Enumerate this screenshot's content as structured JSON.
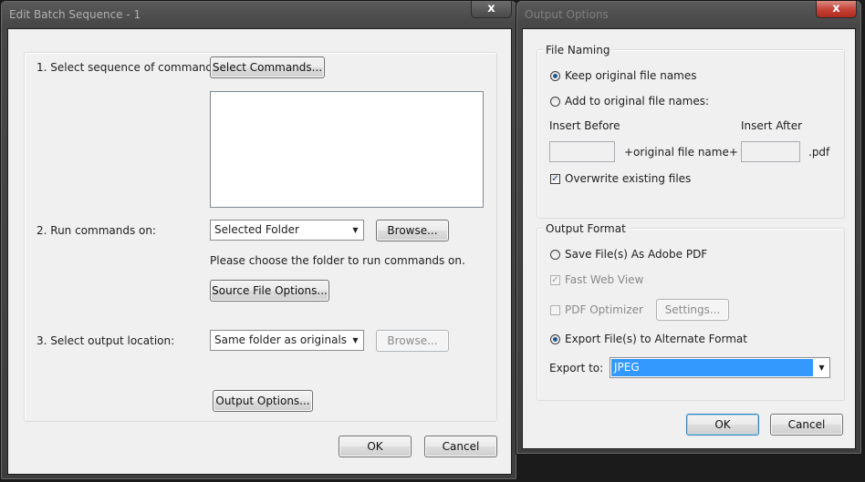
{
  "left_dialog": {
    "title": "Edit Batch Sequence - 1",
    "close_glyph": "x",
    "step1_label": "1. Select sequence of commands:",
    "select_commands_button": "Select Commands...",
    "step2_label": "2. Run commands on:",
    "run_on_value": "Selected Folder",
    "browse_button": "Browse...",
    "hint": "Please choose the folder to run commands on.",
    "source_options_button": "Source File Options...",
    "step3_label": "3. Select output location:",
    "output_location_value": "Same folder as originals",
    "browse_disabled_button": "Browse...",
    "output_options_button": "Output Options...",
    "ok_button": "OK",
    "cancel_button": "Cancel"
  },
  "right_dialog": {
    "title": "Output Options",
    "close_glyph": "x",
    "file_naming_group": "File Naming",
    "keep_original": "Keep original file names",
    "add_to_original": "Add to original file names:",
    "insert_before_label": "Insert Before",
    "insert_after_label": "Insert After",
    "original_name_text": "+original file name+",
    "ext_text": ".pdf",
    "overwrite_label": "Overwrite existing files",
    "output_format_group": "Output Format",
    "save_as_pdf": "Save File(s) As Adobe PDF",
    "fast_web_view": "Fast Web View",
    "pdf_optimizer": "PDF Optimizer",
    "settings_button": "Settings...",
    "export_alternate": "Export File(s) to Alternate Format",
    "export_to_label": "Export to:",
    "export_to_value": "JPEG",
    "ok_button": "OK",
    "cancel_button": "Cancel"
  },
  "icons": {
    "close": "close-icon",
    "dropdown": "chevron-down-icon"
  },
  "colors": {
    "selection": "#3399ff",
    "close_button": "#c7443a"
  }
}
